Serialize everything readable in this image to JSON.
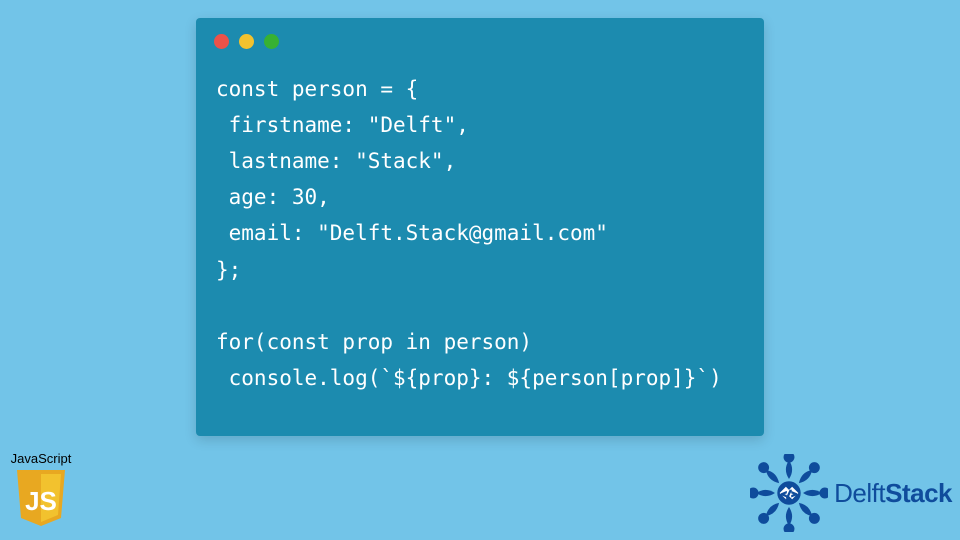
{
  "code": {
    "lines": [
      "const person = {",
      " firstname: \"Delft\",",
      " lastname: \"Stack\",",
      " age: 30,",
      " email: \"Delft.Stack@gmail.com\"",
      "};",
      "",
      "for(const prop in person)",
      " console.log(`${prop}: ${person[prop]}`)"
    ]
  },
  "jsBadge": {
    "label": "JavaScript",
    "shieldText": "JS"
  },
  "brand": {
    "name1": "Delft",
    "name2": "Stack"
  }
}
